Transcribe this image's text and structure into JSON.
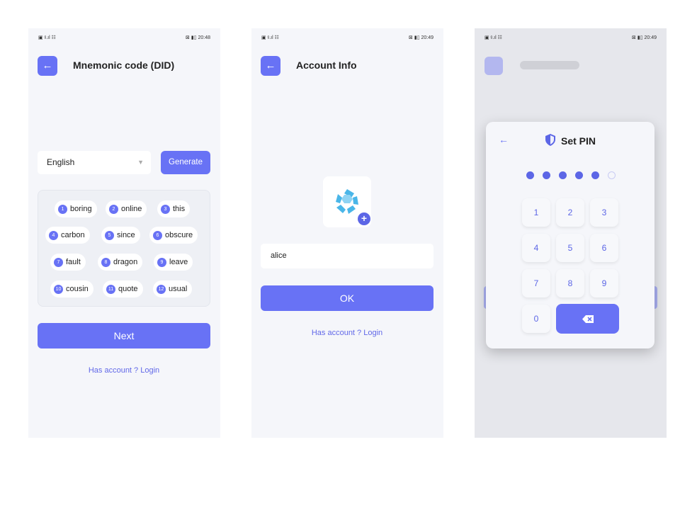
{
  "status": [
    {
      "left": "▣ ᵍ.ıl ☷",
      "right": "⊠ ▮▯ 20:48"
    },
    {
      "left": "▣ ᵍ.ıl ☷",
      "right": "⊠ ▮▯ 20:49"
    },
    {
      "left": "▣ ᵍ.ıl ☷",
      "right": "⊠ ▮▯ 20:49"
    }
  ],
  "screen1": {
    "title": "Mnemonic code (DID)",
    "language": "English",
    "generate_label": "Generate",
    "words": [
      {
        "n": "1",
        "w": "boring"
      },
      {
        "n": "2",
        "w": "online"
      },
      {
        "n": "3",
        "w": "this"
      },
      {
        "n": "4",
        "w": "carbon"
      },
      {
        "n": "5",
        "w": "since"
      },
      {
        "n": "6",
        "w": "obscure"
      },
      {
        "n": "7",
        "w": "fault"
      },
      {
        "n": "8",
        "w": "dragon"
      },
      {
        "n": "9",
        "w": "leave"
      },
      {
        "n": "10",
        "w": "cousin"
      },
      {
        "n": "11",
        "w": "quote"
      },
      {
        "n": "12",
        "w": "usual"
      }
    ],
    "next_label": "Next",
    "login_link": "Has account ? Login"
  },
  "screen2": {
    "title": "Account Info",
    "name_value": "alice",
    "ok_label": "OK",
    "login_link": "Has account ? Login"
  },
  "screen3": {
    "pin_title": "Set PIN",
    "pin_filled": 5,
    "pin_length": 6,
    "keys": [
      "1",
      "2",
      "3",
      "4",
      "5",
      "6",
      "7",
      "8",
      "9",
      "0"
    ]
  },
  "colors": {
    "accent": "#6872f5",
    "background": "#f5f6fa"
  },
  "icons": [
    "back-arrow-icon",
    "chevron-down-icon",
    "avatar-logo-icon",
    "plus-icon",
    "shield-icon",
    "backspace-icon"
  ]
}
